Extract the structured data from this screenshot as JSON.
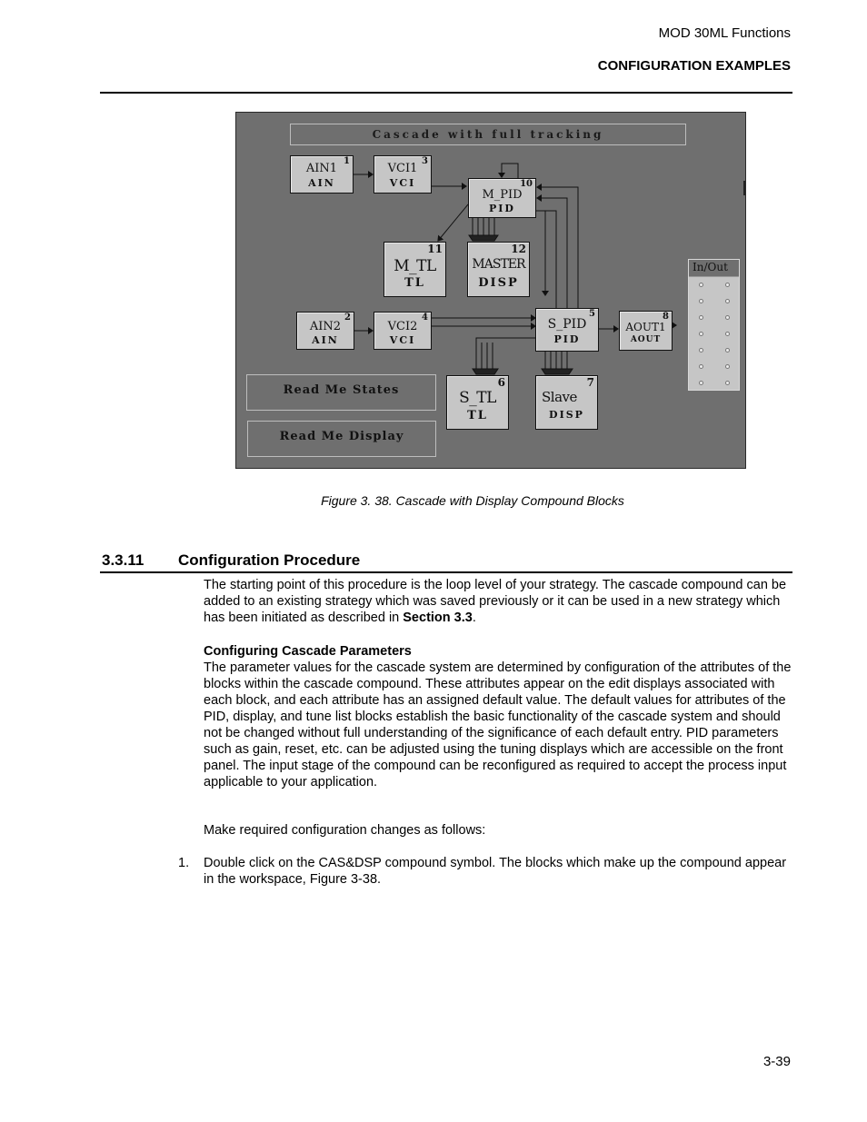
{
  "header": {
    "doc_title": "MOD 30ML Functions",
    "section": "CONFIGURATION EXAMPLES"
  },
  "figure": {
    "screen_title": "Cascade with full tracking",
    "blocks": [
      {
        "id": "ain1",
        "number": "1",
        "name": "AIN1",
        "type": "AIN"
      },
      {
        "id": "vci1",
        "number": "3",
        "name": "VCI1",
        "type": "VCI"
      },
      {
        "id": "m_pid",
        "number": "10",
        "name": "M_PID",
        "type": "PID"
      },
      {
        "id": "m_tl",
        "number": "11",
        "name": "M_TL",
        "type": "TL"
      },
      {
        "id": "master",
        "number": "12",
        "name": "MASTER",
        "type": "DISP"
      },
      {
        "id": "ain2",
        "number": "2",
        "name": "AIN2",
        "type": "AIN"
      },
      {
        "id": "vci2",
        "number": "4",
        "name": "VCI2",
        "type": "VCI"
      },
      {
        "id": "s_pid",
        "number": "5",
        "name": "S_PID",
        "type": "PID"
      },
      {
        "id": "aout1",
        "number": "8",
        "name": "AOUT1",
        "type": "AOUT"
      },
      {
        "id": "s_tl",
        "number": "6",
        "name": "S_TL",
        "type": "TL"
      },
      {
        "id": "slave",
        "number": "7",
        "name": "Slave",
        "type": "DISP"
      }
    ],
    "readme_states": "Read Me States",
    "readme_display": "Read Me Display",
    "inout_label": "In/Out",
    "caption": "Figure 3. 38. Cascade with Display Compound Blocks"
  },
  "section": {
    "number": "3.3.11",
    "title": "Configuration Procedure",
    "intro": "The starting point of this procedure is the loop level of your strategy.  The cascade compound can be added to an existing strategy which was saved previously or it can be used in a new strategy which has been initiated as described in ",
    "intro_ref": "Section 3.3",
    "intro_end": ".",
    "subheading": "Configuring Cascade Parameters",
    "params_text": "The parameter values for the cascade system are determined by configuration of the attributes of the blocks within the cascade compound.  These attributes appear on the edit displays associated with each block, and each attribute has an assigned default value.  The default values for attributes of the PID, display, and tune list blocks establish the basic functionality of the cascade system and should not be changed without full understanding of the significance of each default entry.  PID parameters such as gain, reset, etc. can be adjusted using the tuning displays which are accessible on the front panel.  The input stage of the compound can be reconfigured as required to accept the process input applicable to your application.",
    "changes_intro": "Make required configuration changes as follows:",
    "steps": [
      {
        "num": "1.",
        "text": "Double click on the CAS&DSP compound symbol.  The blocks which make up the compound appear in the workspace, Figure 3-38."
      }
    ]
  },
  "footer": {
    "page_number": "3-39"
  }
}
